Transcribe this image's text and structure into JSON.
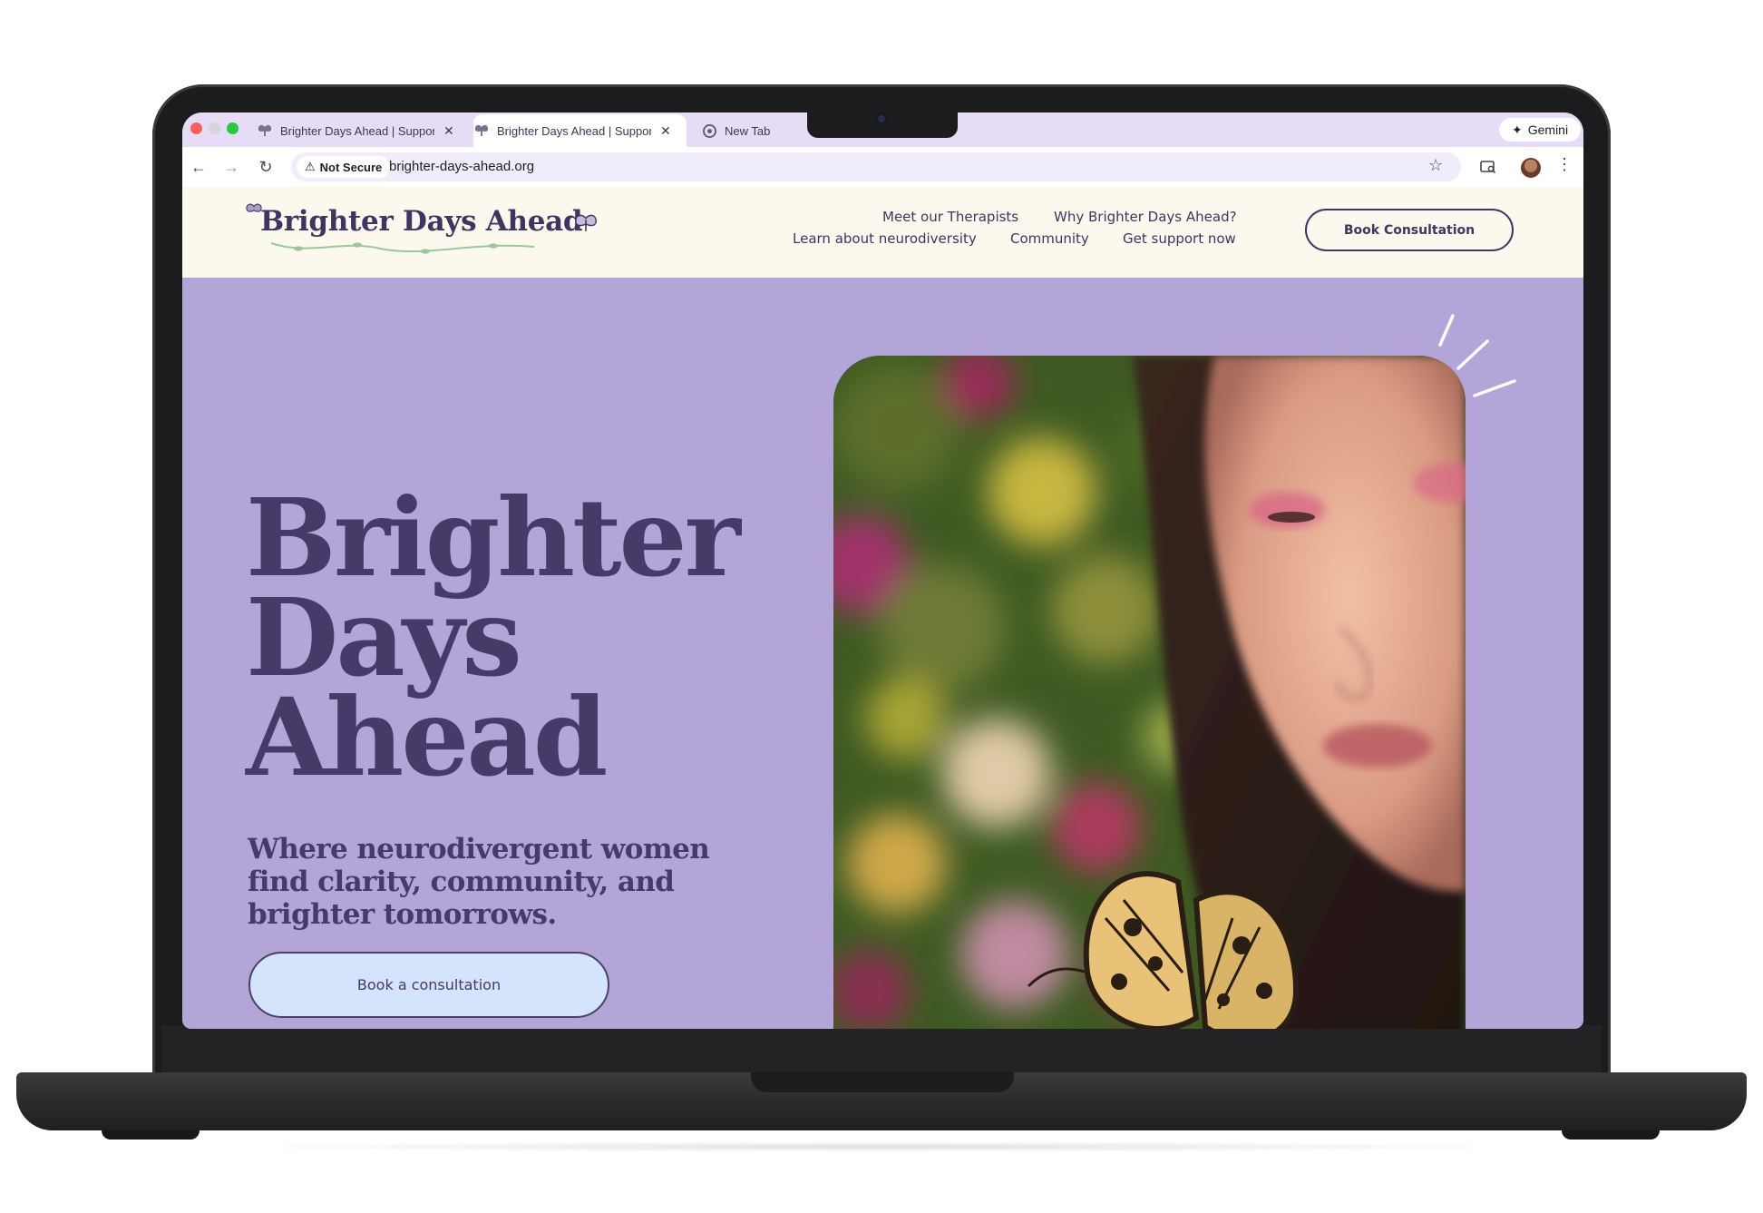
{
  "browser": {
    "tabs": [
      {
        "title": "Brighter Days Ahead | Suppor",
        "active": false
      },
      {
        "title": "Brighter Days Ahead | Suppor",
        "active": true
      },
      {
        "title": "New Tab",
        "active": false
      }
    ],
    "gemini_label": "Gemini",
    "security_label": "Not Secure",
    "url": "brighter-days-ahead.org"
  },
  "site": {
    "logo_text": "Brighter Days Ahead",
    "nav": {
      "therapists": "Meet our Therapists",
      "why": "Why Brighter Days Ahead?",
      "neurodiversity": "Learn about neurodiversity",
      "community": "Community",
      "support": "Get support now"
    },
    "header_cta": "Book Consultation"
  },
  "hero": {
    "title_lines": [
      "Brighter",
      "Days",
      "Ahead"
    ],
    "subtitle": "Where neurodivergent women find clarity, community, and brighter tomorrows.",
    "cta": "Book a consultation",
    "image_subject": "woman with butterfly in a blurred flower garden"
  },
  "colors": {
    "hero_bg": "#b3a5d8",
    "header_bg": "#fbf8ee",
    "brand_text": "#473a68",
    "cta_bg": "#d3e4fb",
    "tab_strip": "#e6dcf6"
  }
}
